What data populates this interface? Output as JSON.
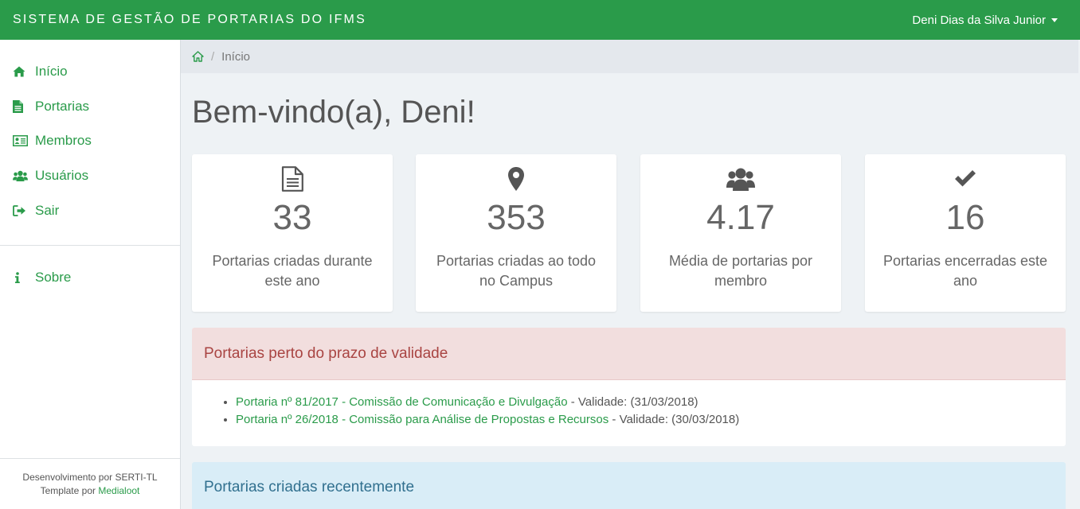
{
  "header": {
    "title": "SISTEMA DE GESTÃO DE PORTARIAS DO IFMS",
    "user_name": "Deni Dias da Silva Junior"
  },
  "sidebar": {
    "items": [
      {
        "label": "Início",
        "icon": "home-icon"
      },
      {
        "label": "Portarias",
        "icon": "document-icon"
      },
      {
        "label": "Membros",
        "icon": "id-card-icon"
      },
      {
        "label": "Usuários",
        "icon": "users-icon"
      },
      {
        "label": "Sair",
        "icon": "sign-out-icon"
      }
    ],
    "about": {
      "label": "Sobre",
      "icon": "info-icon"
    },
    "footer": {
      "dev_line": "Desenvolvimento por SERTI-TL",
      "template_prefix": "Template por",
      "template_link": "Medialoot"
    }
  },
  "breadcrumb": {
    "current": "Início",
    "separator": "/"
  },
  "main": {
    "welcome": "Bem-vindo(a), Deni!",
    "stats": [
      {
        "value": "33",
        "label": "Portarias criadas durante este ano",
        "icon": "document-icon"
      },
      {
        "value": "353",
        "label": "Portarias criadas ao todo no Campus",
        "icon": "map-marker-icon"
      },
      {
        "value": "4.17",
        "label": "Média de portarias por membro",
        "icon": "users-icon"
      },
      {
        "value": "16",
        "label": "Portarias encerradas este ano",
        "icon": "check-icon"
      }
    ],
    "expiring": {
      "title": "Portarias perto do prazo de validade",
      "items": [
        {
          "link": "Portaria nº 81/2017 - Comissão de Comunicação e Divulgação",
          "suffix": "- Validade: (31/03/2018)"
        },
        {
          "link": "Portaria nº 26/2018 - Comissão para Análise de Propostas e Recursos",
          "suffix": "- Validade: (30/03/2018)"
        }
      ]
    },
    "recent": {
      "title": "Portarias criadas recentemente"
    }
  },
  "colors": {
    "brand_green": "#2a9b4a",
    "danger_header": "#f2dede",
    "danger_text": "#a94442",
    "info_header": "#d9edf7",
    "info_text": "#31708f"
  }
}
